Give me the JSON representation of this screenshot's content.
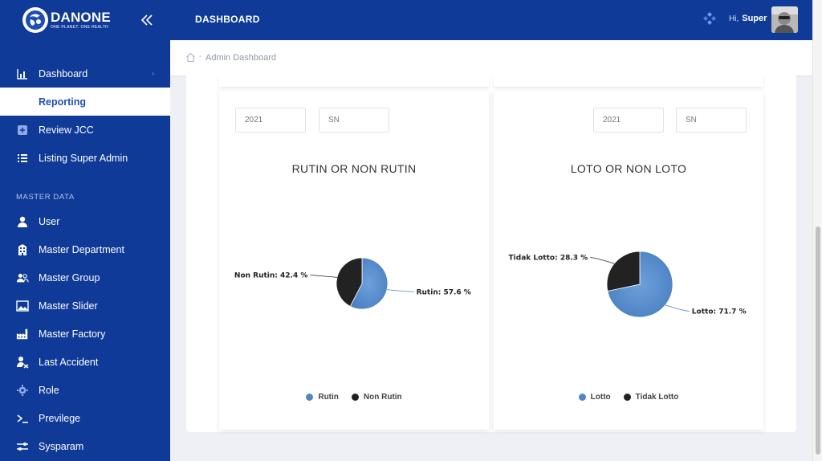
{
  "brand": {
    "name": "DANONE",
    "tagline": "ONE PLANET. ONE HEALTH"
  },
  "topbar": {
    "title": "DASHBOARD",
    "greeting": "Hi,",
    "user_name": "Super"
  },
  "breadcrumb": {
    "text": "Admin Dashboard"
  },
  "sidebar": {
    "items": [
      {
        "label": "Dashboard",
        "icon": "bar-chart-icon"
      },
      {
        "label": "Reporting"
      },
      {
        "label": "Review JCC",
        "icon": "plus-square-icon"
      },
      {
        "label": "Listing Super Admin",
        "icon": "list-icon"
      }
    ],
    "section_label": "MASTER DATA",
    "master_items": [
      {
        "label": "User",
        "icon": "user-icon"
      },
      {
        "label": "Master Department",
        "icon": "building-icon"
      },
      {
        "label": "Master Group",
        "icon": "group-icon"
      },
      {
        "label": "Master Slider",
        "icon": "image-icon"
      },
      {
        "label": "Master Factory",
        "icon": "factory-icon"
      },
      {
        "label": "Last Accident",
        "icon": "accident-icon"
      },
      {
        "label": "Role",
        "icon": "gear-icon"
      },
      {
        "label": "Previlege",
        "icon": "terminal-icon"
      },
      {
        "label": "Sysparam",
        "icon": "sliders-icon"
      }
    ]
  },
  "cards": {
    "left": {
      "year": "2021",
      "type": "SN"
    },
    "right": {
      "year": "2021",
      "type": "SN"
    }
  },
  "colors": {
    "primary": "#0f3a98",
    "series_blue": "#4f86c6",
    "series_dark": "#222222"
  },
  "chart_data": [
    {
      "type": "pie",
      "title": "RUTIN OR NON RUTIN",
      "slices": [
        {
          "name": "Rutin",
          "value": 57.6,
          "label": "Rutin: 57.6 %",
          "color": "#4f86c6"
        },
        {
          "name": "Non Rutin",
          "value": 42.4,
          "label": "Non Rutin: 42.4 %",
          "color": "#222222"
        }
      ],
      "legend": "bottom"
    },
    {
      "type": "pie",
      "title": "LOTO OR NON LOTO",
      "slices": [
        {
          "name": "Lotto",
          "value": 71.7,
          "label": "Lotto: 71.7 %",
          "color": "#4f86c6"
        },
        {
          "name": "Tidak Lotto",
          "value": 28.3,
          "label": "Tidak Lotto: 28.3 %",
          "color": "#222222"
        }
      ],
      "legend": "bottom"
    }
  ]
}
